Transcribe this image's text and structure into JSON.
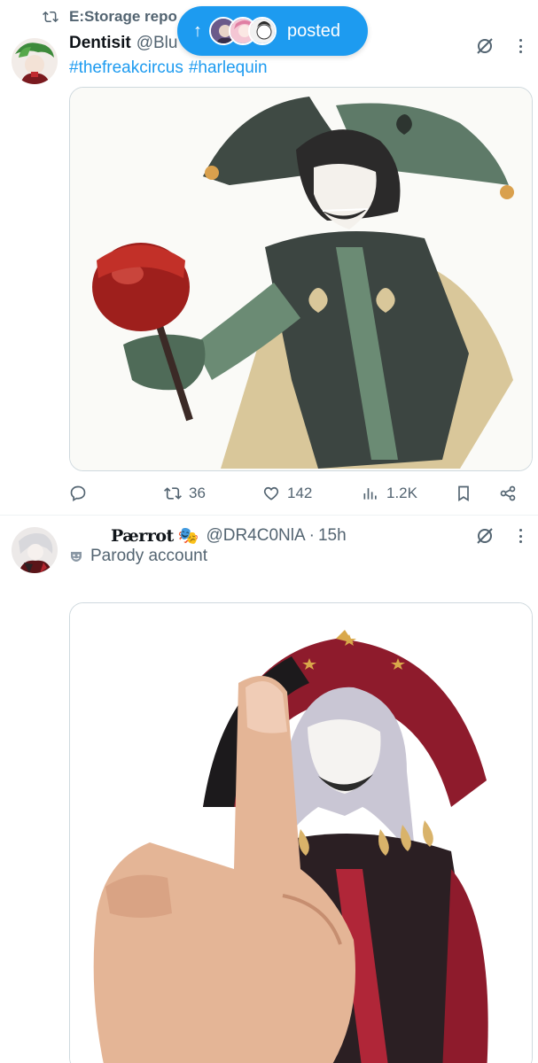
{
  "repost_banner": {
    "text": "E:Storage repo"
  },
  "posted_pill": {
    "label": "posted"
  },
  "post1": {
    "name": "Dentisit",
    "handle": "@Blu",
    "hashtags": [
      "#thefreakcircus",
      "#harlequin"
    ],
    "stats": {
      "reposts": "36",
      "likes": "142",
      "views": "1.2K"
    }
  },
  "post2": {
    "name": "Pærrot",
    "badge": "🎭",
    "handle": "@DR4C0NlA",
    "separator": "·",
    "time": "15h",
    "label": "Parody account"
  },
  "colors": {
    "accent": "#1d9bf0",
    "muted": "#536471",
    "border": "#cfd9de"
  },
  "icons": [
    "repost-icon",
    "grok-icon",
    "more-icon",
    "reply-icon",
    "like-icon",
    "views-icon",
    "bookmark-icon",
    "share-icon",
    "parody-icon"
  ]
}
